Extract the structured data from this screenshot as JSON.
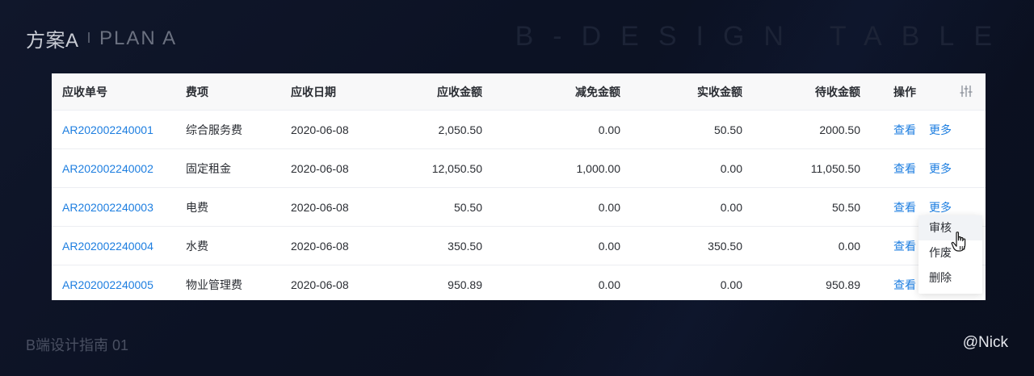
{
  "header": {
    "title_cn": "方案A",
    "separator": "I",
    "title_en": "PLAN A",
    "watermark": "B-DESIGN TABLE"
  },
  "footer": {
    "left": "B端设计指南 01",
    "right": "@Nick"
  },
  "table": {
    "columns": [
      "应收单号",
      "费项",
      "应收日期",
      "应收金额",
      "减免金额",
      "实收金额",
      "待收金额",
      "操作"
    ],
    "rows": [
      {
        "id": "AR202002240001",
        "item": "综合服务费",
        "date": "2020-06-08",
        "due": "2,050.50",
        "waived": "0.00",
        "paid": "50.50",
        "pending": "2000.50",
        "view": "查看",
        "more": "更多"
      },
      {
        "id": "AR202002240002",
        "item": "固定租金",
        "date": "2020-06-08",
        "due": "12,050.50",
        "waived": "1,000.00",
        "paid": "0.00",
        "pending": "11,050.50",
        "view": "查看",
        "more": "更多"
      },
      {
        "id": "AR202002240003",
        "item": "电费",
        "date": "2020-06-08",
        "due": "50.50",
        "waived": "0.00",
        "paid": "0.00",
        "pending": "50.50",
        "view": "查看",
        "more": "更多"
      },
      {
        "id": "AR202002240004",
        "item": "水费",
        "date": "2020-06-08",
        "due": "350.50",
        "waived": "0.00",
        "paid": "350.50",
        "pending": "0.00",
        "view": "查看",
        "more": ""
      },
      {
        "id": "AR202002240005",
        "item": "物业管理费",
        "date": "2020-06-08",
        "due": "950.89",
        "waived": "0.00",
        "paid": "0.00",
        "pending": "950.89",
        "view": "查看",
        "more": ""
      }
    ]
  },
  "dropdown": {
    "items": [
      "审核",
      "作废",
      "删除"
    ]
  },
  "colors": {
    "link": "#1d7ee0",
    "background": "#0c1224"
  },
  "icons": {
    "settings": "column-settings-icon",
    "cursor": "hand-pointer-icon"
  }
}
